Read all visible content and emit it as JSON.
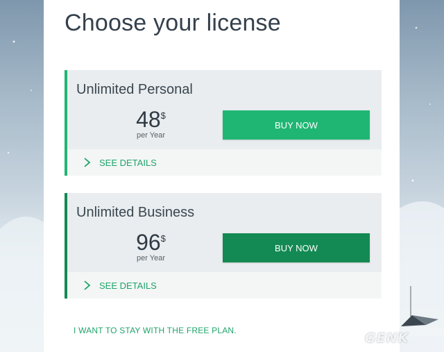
{
  "page": {
    "title": "Choose your license"
  },
  "plans": [
    {
      "name": "Unlimited Personal",
      "price": "48",
      "currency": "$",
      "period": "per Year",
      "buy_label": "BUY NOW",
      "details_label": "SEE DETAILS"
    },
    {
      "name": "Unlimited Business",
      "price": "96",
      "currency": "$",
      "period": "per Year",
      "buy_label": "BUY NOW",
      "details_label": "SEE DETAILS"
    }
  ],
  "free_plan_label": "I WANT TO STAY WITH THE FREE PLAN.",
  "watermark": "GENK",
  "colors": {
    "accent": "#1fb673",
    "accent_dark": "#138a53",
    "link": "#1ea46a",
    "title": "#34404c"
  },
  "icons": {
    "details": "chevron-right-icon"
  }
}
